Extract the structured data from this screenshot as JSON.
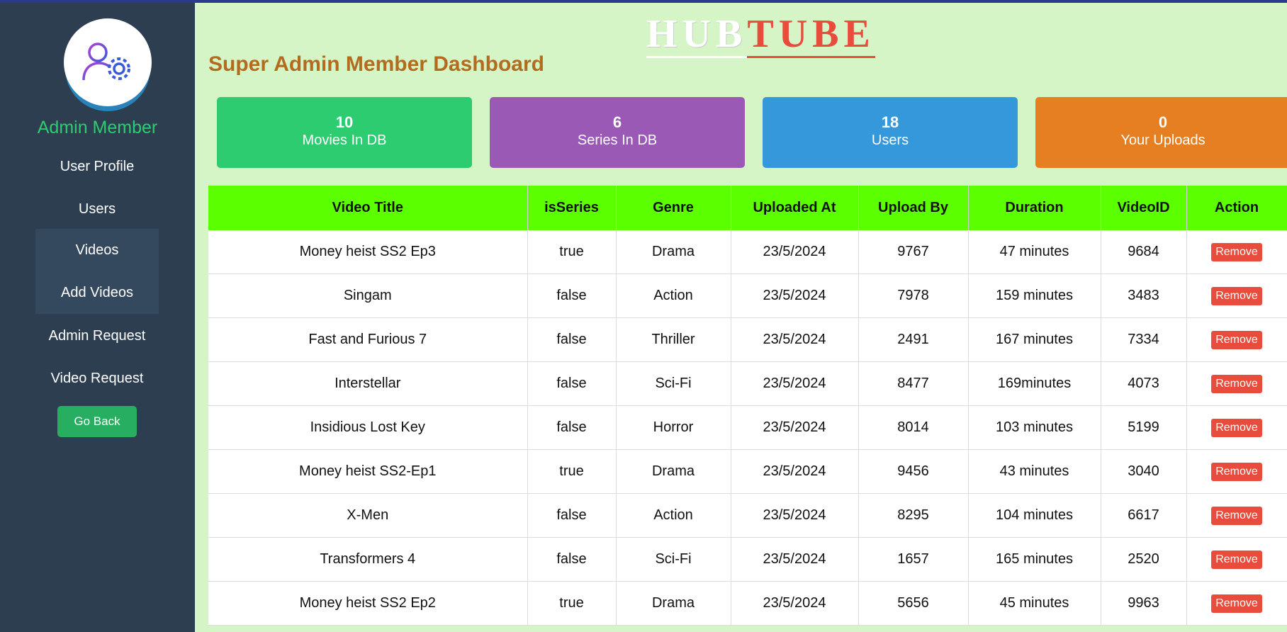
{
  "logo": {
    "part1": "HUB",
    "part2": "TUBE"
  },
  "sidebar": {
    "admin_name": "Admin Member",
    "items": [
      {
        "label": "User Profile"
      },
      {
        "label": "Users"
      },
      {
        "label": "Videos"
      },
      {
        "label": "Add Videos"
      },
      {
        "label": "Admin Request"
      },
      {
        "label": "Video Request"
      }
    ],
    "go_back": "Go Back",
    "avatar_icon": "user-gear-icon"
  },
  "page": {
    "title": "Super Admin Member Dashboard"
  },
  "cards": [
    {
      "value": "10",
      "label": "Movies In DB",
      "color": "#2ecc71"
    },
    {
      "value": "6",
      "label": "Series In DB",
      "color": "#9b59b6"
    },
    {
      "value": "18",
      "label": "Users",
      "color": "#3498db"
    },
    {
      "value": "0",
      "label": "Your Uploads",
      "color": "#e67e22"
    }
  ],
  "table": {
    "headers": [
      "Video Title",
      "isSeries",
      "Genre",
      "Uploaded At",
      "Upload By",
      "Duration",
      "VideoID",
      "Action"
    ],
    "action_label": "Remove",
    "rows": [
      [
        "Money heist SS2 Ep3",
        "true",
        "Drama",
        "23/5/2024",
        "9767",
        "47 minutes",
        "9684"
      ],
      [
        "Singam",
        "false",
        "Action",
        "23/5/2024",
        "7978",
        "159 minutes",
        "3483"
      ],
      [
        "Fast and Furious 7",
        "false",
        "Thriller",
        "23/5/2024",
        "2491",
        "167 minutes",
        "7334"
      ],
      [
        "Interstellar",
        "false",
        "Sci-Fi",
        "23/5/2024",
        "8477",
        "169minutes",
        "4073"
      ],
      [
        "Insidious Lost Key",
        "false",
        "Horror",
        "23/5/2024",
        "8014",
        "103 minutes",
        "5199"
      ],
      [
        "Money heist SS2-Ep1",
        "true",
        "Drama",
        "23/5/2024",
        "9456",
        "43 minutes",
        "3040"
      ],
      [
        "X-Men",
        "false",
        "Action",
        "23/5/2024",
        "8295",
        "104 minutes",
        "6617"
      ],
      [
        "Transformers 4",
        "false",
        "Sci-Fi",
        "23/5/2024",
        "1657",
        "165 minutes",
        "2520"
      ],
      [
        "Money heist SS2 Ep2",
        "true",
        "Drama",
        "23/5/2024",
        "5656",
        "45 minutes",
        "9963"
      ]
    ]
  },
  "colors": {
    "sidebar_bg": "#2c3e50",
    "page_bg": "#d6f5c6",
    "header_bg": "#5cff00",
    "remove": "#e74c3c"
  }
}
